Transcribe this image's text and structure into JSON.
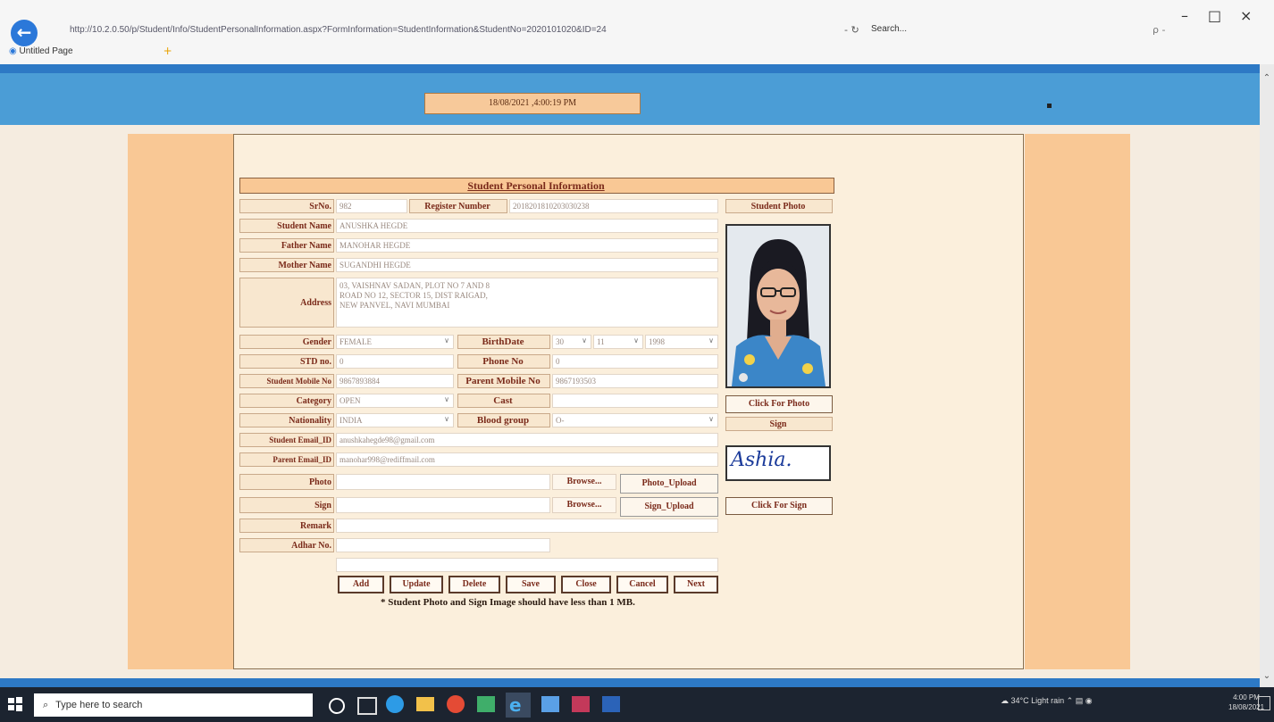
{
  "browser": {
    "url": "http://10.2.0.50/p/Student/Info/StudentPersonalInformation.aspx?FormInformation=StudentInformation&StudentNo=2020101020&ID=24",
    "search_placeholder": "Search...",
    "tab_title": "Untitled Page",
    "refresh_glyph": "- ↻",
    "search_right": "ρ -"
  },
  "header": {
    "datetime": "18/08/2021 ,4:00:19 PM"
  },
  "form": {
    "title": "Student Personal Information",
    "labels": {
      "srno": "SrNo.",
      "register_number": "Register Number",
      "student_name": "Student Name",
      "father_name": "Father Name",
      "mother_name": "Mother Name",
      "address": "Address",
      "gender": "Gender",
      "birthdate": "BirthDate",
      "std_no": "STD no.",
      "phone_no": "Phone No",
      "student_mobile": "Student Mobile No",
      "parent_mobile": "Parent Mobile No",
      "category": "Category",
      "cast": "Cast",
      "nationality": "Nationality",
      "blood_group": "Blood group",
      "student_email": "Student Email_ID",
      "parent_email": "Parent Email_ID",
      "photo": "Photo",
      "sign": "Sign",
      "remark": "Remark",
      "adhar": "Adhar No.",
      "student_photo": "Student Photo",
      "sign_header": "Sign"
    },
    "values": {
      "srno": "982",
      "register_number": "2018201810203030238",
      "student_name": "ANUSHKA HEGDE",
      "father_name": "MANOHAR HEGDE",
      "mother_name": "SUGANDHI HEGDE",
      "address_line1": "03, VAISHNAV SADAN, PLOT NO 7 AND 8",
      "address_line2": "ROAD NO 12, SECTOR 15, DIST RAIGAD,",
      "address_line3": "NEW PANVEL, NAVI MUMBAI",
      "gender": "FEMALE",
      "birth_day": "30",
      "birth_month": "11",
      "birth_year": "1998",
      "std_no": "0",
      "phone_no": "0",
      "student_mobile": "9867893884",
      "parent_mobile": "9867193503",
      "category": "OPEN",
      "cast": "",
      "nationality": "INDIA",
      "blood_group": "O-",
      "student_email": "anushkahegde98@gmail.com",
      "parent_email": "manohar998@rediffmail.com",
      "signature": "Ashia."
    },
    "buttons": {
      "browse_photo": "Browse...",
      "photo_upload": "Photo_Upload",
      "browse_sign": "Browse...",
      "sign_upload": "Sign_Upload",
      "click_for_photo": "Click For Photo",
      "click_for_sign": "Click For Sign",
      "add": "Add",
      "update": "Update",
      "delete": "Delete",
      "save": "Save",
      "close": "Close",
      "cancel": "Cancel",
      "next": "Next"
    },
    "note": "* Student Photo and Sign Image should have less than 1 MB."
  },
  "taskbar": {
    "search_placeholder": "Type here to search",
    "weather": "34°C  Light rain",
    "time": "4:00 PM",
    "date": "18/08/2021"
  }
}
